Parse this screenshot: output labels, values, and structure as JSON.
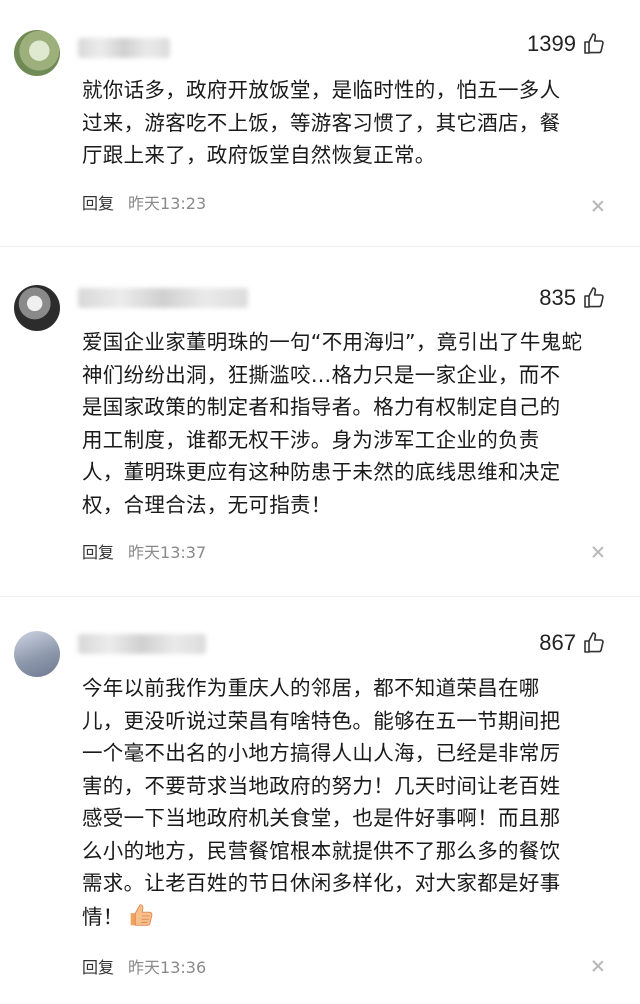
{
  "comments": [
    {
      "likes": "1399",
      "lines": [
        "就你话多，政府开放饭堂，是临时性的，怕五一多人",
        "过来，游客吃不上饭，等游客习惯了，其它酒店，餐",
        "厅跟上来了，政府饭堂自然恢复正常。"
      ],
      "reply_label": "回复",
      "time": "昨天13:23"
    },
    {
      "likes": "835",
      "lines": [
        "爱国企业家董明珠的一句“不用海归”，竟引出了牛鬼蛇",
        "神们纷纷出洞，狂撕滥咬…格力只是一家企业，而不",
        "是国家政策的制定者和指导者。格力有权制定自己的",
        "用工制度，谁都无权干涉。身为涉军工企业的负责",
        "人，董明珠更应有这种防患于未然的底线思维和决定",
        "权，合理合法，无可指责！"
      ],
      "reply_label": "回复",
      "time": "昨天13:37"
    },
    {
      "likes": "867",
      "lines": [
        "今年以前我作为重庆人的邻居，都不知道荣昌在哪",
        "儿，更没听说过荣昌有啥特色。能够在五一节期间把",
        "一个毫不出名的小地方搞得人山人海，已经是非常厉",
        "害的，不要苛求当地政府的努力！几天时间让老百姓",
        "感受一下当地政府机关食堂，也是件好事啊！而且那",
        "么小的地方，民营餐馆根本就提供不了那么多的餐饮",
        "需求。让老百姓的节日休闲多样化，对大家都是好事",
        "情！"
      ],
      "reply_label": "回复",
      "time": "昨天13:36"
    }
  ]
}
